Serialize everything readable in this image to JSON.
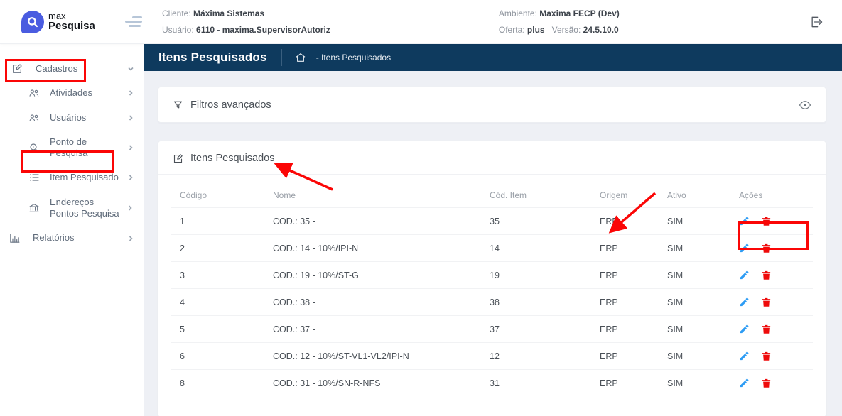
{
  "header": {
    "logo_line1": "max",
    "logo_line2": "Pesquisa",
    "client_label": "Cliente:",
    "client_value": "Máxima Sistemas",
    "user_label": "Usuário:",
    "user_value": "6110 - maxima.SupervisorAutoriz",
    "env_label": "Ambiente:",
    "env_value": "Maxima FECP (Dev)",
    "offer_label": "Oferta:",
    "offer_value": "plus",
    "version_label": "Versão:",
    "version_value": "24.5.10.0"
  },
  "sidebar": {
    "items": [
      {
        "label": "Cadastros"
      },
      {
        "label": "Atividades"
      },
      {
        "label": "Usuários"
      },
      {
        "label": "Ponto de Pesquisa"
      },
      {
        "label": "Item Pesquisado"
      },
      {
        "label": "Endereços Pontos Pesquisa"
      },
      {
        "label": "Relatórios"
      }
    ]
  },
  "pagebar": {
    "title": "Itens Pesquisados",
    "breadcrumb": "- Itens Pesquisados"
  },
  "filters": {
    "label": "Filtros avançados"
  },
  "card": {
    "title": "Itens Pesquisados"
  },
  "table": {
    "columns": [
      "Código",
      "Nome",
      "Cód. Item",
      "Origem",
      "Ativo",
      "Ações"
    ],
    "rows": [
      {
        "codigo": "1",
        "nome": "COD.: 35 -",
        "cod_item": "35",
        "origem": "ERP",
        "ativo": "SIM"
      },
      {
        "codigo": "2",
        "nome": "COD.: 14 - 10%/IPI-N",
        "cod_item": "14",
        "origem": "ERP",
        "ativo": "SIM"
      },
      {
        "codigo": "3",
        "nome": "COD.: 19 - 10%/ST-G",
        "cod_item": "19",
        "origem": "ERP",
        "ativo": "SIM"
      },
      {
        "codigo": "4",
        "nome": "COD.: 38 -",
        "cod_item": "38",
        "origem": "ERP",
        "ativo": "SIM"
      },
      {
        "codigo": "5",
        "nome": "COD.: 37 -",
        "cod_item": "37",
        "origem": "ERP",
        "ativo": "SIM"
      },
      {
        "codigo": "6",
        "nome": "COD.: 12 - 10%/ST-VL1-VL2/IPI-N",
        "cod_item": "12",
        "origem": "ERP",
        "ativo": "SIM"
      },
      {
        "codigo": "8",
        "nome": "COD.: 31 - 10%/SN-R-NFS",
        "cod_item": "31",
        "origem": "ERP",
        "ativo": "SIM"
      }
    ]
  },
  "colors": {
    "navy_bar": "#0e3a5e",
    "logo_blue": "#4a5ce0",
    "edit_icon_blue": "#2d9cf4",
    "delete_icon_red": "#ee0b0b",
    "annotation_red": "#fb0606",
    "background": "#eef0f5"
  }
}
